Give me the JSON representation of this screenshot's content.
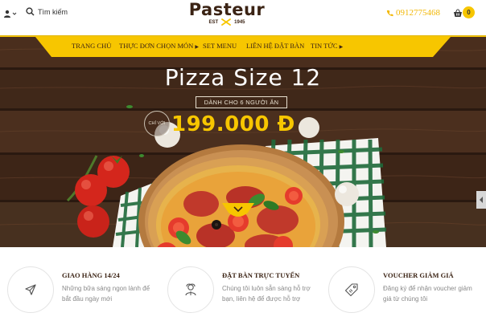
{
  "header": {
    "search_label": "Tìm kiếm",
    "logo": {
      "name": "Pasteur",
      "est": "EST",
      "year": "1945"
    },
    "phone": "0912775468",
    "cart_count": "0"
  },
  "nav": {
    "items": [
      {
        "label": "TRANG CHỦ",
        "has_caret": false
      },
      {
        "label": "THỰC ĐƠN CHỌN MÓN",
        "has_caret": true
      },
      {
        "label": "SET MENU",
        "has_caret": false
      },
      {
        "label": "LIÊN HỆ ĐẶT BÀN",
        "has_caret": false
      },
      {
        "label": "TIN TỨC",
        "has_caret": true
      }
    ]
  },
  "hero": {
    "title": "Pizza Size 12",
    "subtitle": "DÀNH CHO 6 NGƯỜI ĂN",
    "price_prefix": "CHỈ VỚI",
    "price": "199.000 Đ"
  },
  "features": [
    {
      "icon": "send-icon",
      "title": "GIAO HÀNG 14/24",
      "desc": "Những bữa sáng ngon lành để bắt đầu ngày mới"
    },
    {
      "icon": "chef-icon",
      "title": "ĐẶT BÀN TRỰC TUYẾN",
      "desc": "Chúng tôi luôn sẵn sàng hỗ trợ bạn, liên hệ để được hỗ trợ"
    },
    {
      "icon": "tag-icon",
      "title": "VOUCHER GIẢM GIÁ",
      "desc": "Đăng ký để nhận voucher giảm giá từ chúng tôi"
    }
  ],
  "colors": {
    "accent_yellow": "#f7c600",
    "brand_brown": "#3b2314",
    "phone_color": "#f2b705",
    "muted_text": "#8a8a8a"
  }
}
